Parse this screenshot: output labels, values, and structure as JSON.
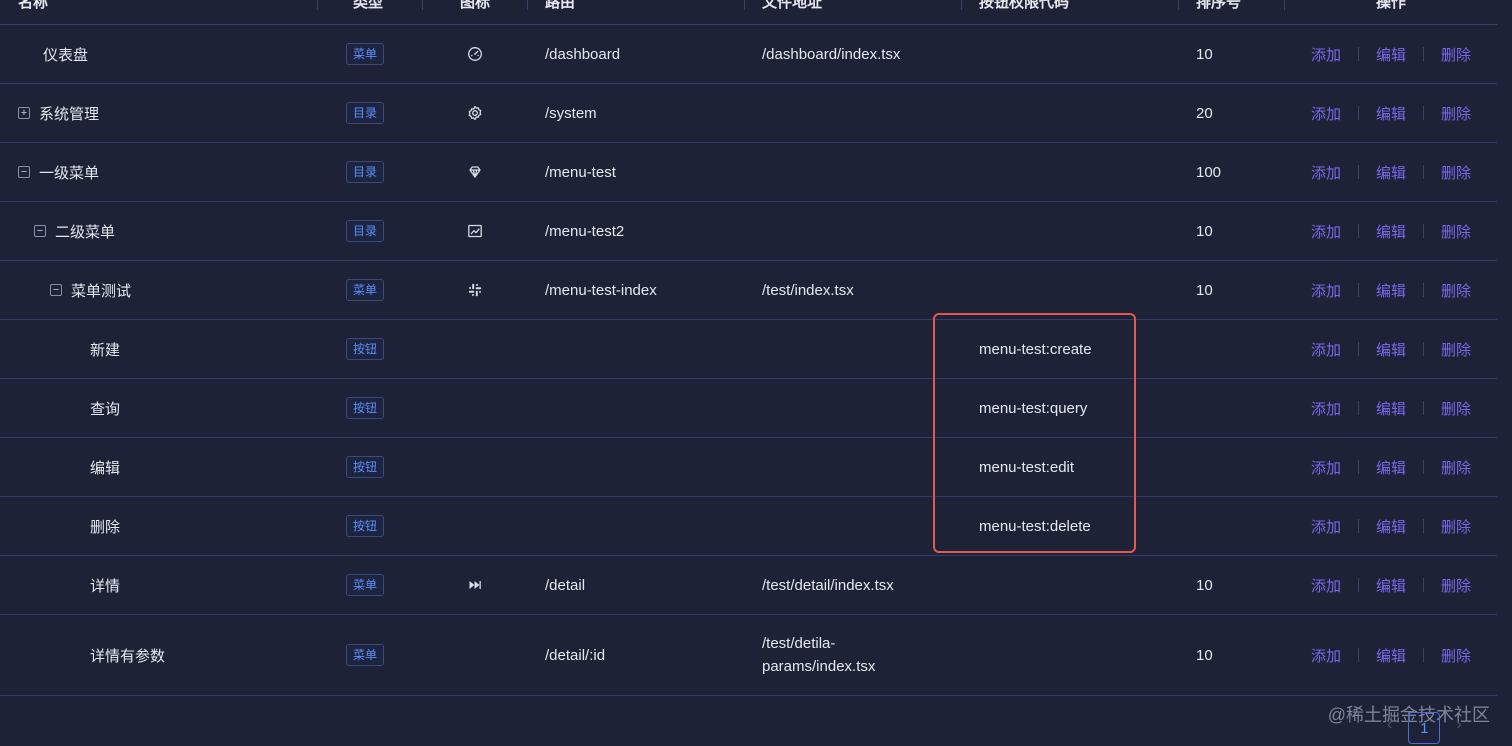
{
  "table": {
    "columns": [
      "名称",
      "类型",
      "图标",
      "路由",
      "文件地址",
      "按钮权限代码",
      "排序号",
      "操作"
    ],
    "action_labels": {
      "add": "添加",
      "edit": "编辑",
      "delete": "删除"
    },
    "rows": [
      {
        "name": "仪表盘",
        "level": 0,
        "expander": "",
        "type": "菜单",
        "icon": "dashboard-icon",
        "route": "/dashboard",
        "file": "/dashboard/index.tsx",
        "file2": "",
        "permission": "",
        "order": "10"
      },
      {
        "name": "系统管理",
        "level": 0,
        "expander": "+",
        "type": "目录",
        "icon": "gear-icon",
        "route": "/system",
        "file": "",
        "file2": "",
        "permission": "",
        "order": "20"
      },
      {
        "name": "一级菜单",
        "level": 0,
        "expander": "−",
        "type": "目录",
        "icon": "gem-icon",
        "route": "/menu-test",
        "file": "",
        "file2": "",
        "permission": "",
        "order": "100"
      },
      {
        "name": "二级菜单",
        "level": 1,
        "expander": "−",
        "type": "目录",
        "icon": "line-chart-icon",
        "route": "/menu-test2",
        "file": "",
        "file2": "",
        "permission": "",
        "order": "10"
      },
      {
        "name": "菜单测试",
        "level": 2,
        "expander": "−",
        "type": "菜单",
        "icon": "slack-icon",
        "route": "/menu-test-index",
        "file": "/test/index.tsx",
        "file2": "",
        "permission": "",
        "order": "10"
      },
      {
        "name": "新建",
        "level": 3,
        "expander": "",
        "type": "按钮",
        "icon": "",
        "route": "",
        "file": "",
        "file2": "",
        "permission": "menu-test:create",
        "order": ""
      },
      {
        "name": "查询",
        "level": 3,
        "expander": "",
        "type": "按钮",
        "icon": "",
        "route": "",
        "file": "",
        "file2": "",
        "permission": "menu-test:query",
        "order": ""
      },
      {
        "name": "编辑",
        "level": 3,
        "expander": "",
        "type": "按钮",
        "icon": "",
        "route": "",
        "file": "",
        "file2": "",
        "permission": "menu-test:edit",
        "order": ""
      },
      {
        "name": "删除",
        "level": 3,
        "expander": "",
        "type": "按钮",
        "icon": "",
        "route": "",
        "file": "",
        "file2": "",
        "permission": "menu-test:delete",
        "order": ""
      },
      {
        "name": "详情",
        "level": 3,
        "expander": "",
        "type": "菜单",
        "icon": "fast-forward-icon",
        "route": "/detail",
        "file": "/test/detail/index.tsx",
        "file2": "",
        "permission": "",
        "order": "10"
      },
      {
        "name": "详情有参数",
        "level": 3,
        "expander": "",
        "type": "菜单",
        "icon": "",
        "route": "/detail/:id",
        "file": "/test/detila-",
        "file2": "params/index.tsx",
        "permission": "",
        "order": "10"
      }
    ]
  },
  "pagination": {
    "prev": "‹",
    "current": "1",
    "next": "›"
  },
  "watermark": "@稀土掘金技术社区"
}
